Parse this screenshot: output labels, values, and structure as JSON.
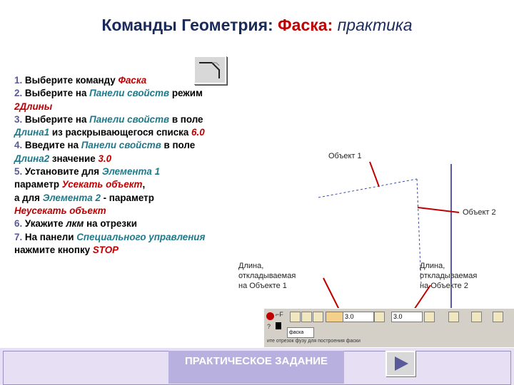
{
  "title": {
    "part1": "Команды Геометрия:",
    "part2": "Фаска:",
    "part3": "практика"
  },
  "steps": {
    "s1_num": "1.",
    "s1_text": " Выберите команду ",
    "s1_cmd": "Фаска",
    "s2_num": "2.",
    "s2_text": " Выберите на ",
    "s2_panel": "Панели свойств",
    "s2_tail": " режим",
    "s2_mode": "2Длины",
    "s3_num": "3.",
    "s3_text": " Выберите на ",
    "s3_panel": "Панели свойств",
    "s3_tail": " в поле",
    "s3_field": "Длина1",
    "s3_tail2": " из раскрывающегося списка ",
    "s3_value": "6.0",
    "s4_num": "4.",
    "s4_text": " Введите на ",
    "s4_panel": "Панели свойств",
    "s4_tail": " в поле",
    "s4_field": "Длина2",
    "s4_tail2": "  значение  ",
    "s4_value": "3.0",
    "s5_num": "5.",
    "s5_text": " Установите для ",
    "s5_elem1": "Элемента 1",
    "s5_line2": "параметр ",
    "s5_param1": "Усекать объект",
    "s5_comma": ",",
    "s5_line3": "а для  ",
    "s5_elem2": "Элемента 2",
    "s5_line3b": " - параметр",
    "s5_param2": "Неусекать объект",
    "s6_num": "6.",
    "s6_text": " Укажите ",
    "s6_lkm": "лкм",
    "s6_tail": "  на отрезки",
    "s7_num": "7.",
    "s7_text": " На панели ",
    "s7_panel": "Специального управления",
    "s7_line2": "нажмите кнопку ",
    "s7_stop": "STOP"
  },
  "diagram": {
    "object1_label": "Объект 1",
    "object2_label": "Объект 2",
    "length1_label": [
      "Длина,",
      "откладываемая",
      "на Объекте 1"
    ],
    "length2_label": [
      "Длина,",
      "откладываемая",
      "на Объекте 2"
    ]
  },
  "toolbar": {
    "field1_value": "3.0",
    "field2_value": "3.0",
    "chip_label": "фаска",
    "hint_text": "ите отрезок фузу для построения фаски"
  },
  "footer": {
    "practice_label": "ПРАКТИЧЕСКОЕ ЗАДАНИЕ"
  },
  "colors": {
    "title": "#1a2a5a",
    "accent_red": "#c00000",
    "teal": "#1e7a8a",
    "step_number": "#5a5a9a",
    "footer_bg": "#e7e0f4",
    "practice_btn": "#b8b0de"
  }
}
